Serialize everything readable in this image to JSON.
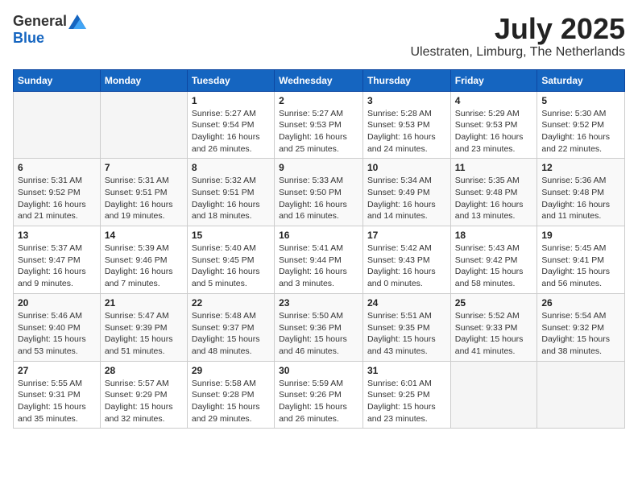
{
  "logo": {
    "general": "General",
    "blue": "Blue"
  },
  "title": {
    "month_year": "July 2025",
    "location": "Ulestraten, Limburg, The Netherlands"
  },
  "calendar": {
    "headers": [
      "Sunday",
      "Monday",
      "Tuesday",
      "Wednesday",
      "Thursday",
      "Friday",
      "Saturday"
    ],
    "weeks": [
      [
        {
          "day": "",
          "info": ""
        },
        {
          "day": "",
          "info": ""
        },
        {
          "day": "1",
          "info": "Sunrise: 5:27 AM\nSunset: 9:54 PM\nDaylight: 16 hours\nand 26 minutes."
        },
        {
          "day": "2",
          "info": "Sunrise: 5:27 AM\nSunset: 9:53 PM\nDaylight: 16 hours\nand 25 minutes."
        },
        {
          "day": "3",
          "info": "Sunrise: 5:28 AM\nSunset: 9:53 PM\nDaylight: 16 hours\nand 24 minutes."
        },
        {
          "day": "4",
          "info": "Sunrise: 5:29 AM\nSunset: 9:53 PM\nDaylight: 16 hours\nand 23 minutes."
        },
        {
          "day": "5",
          "info": "Sunrise: 5:30 AM\nSunset: 9:52 PM\nDaylight: 16 hours\nand 22 minutes."
        }
      ],
      [
        {
          "day": "6",
          "info": "Sunrise: 5:31 AM\nSunset: 9:52 PM\nDaylight: 16 hours\nand 21 minutes."
        },
        {
          "day": "7",
          "info": "Sunrise: 5:31 AM\nSunset: 9:51 PM\nDaylight: 16 hours\nand 19 minutes."
        },
        {
          "day": "8",
          "info": "Sunrise: 5:32 AM\nSunset: 9:51 PM\nDaylight: 16 hours\nand 18 minutes."
        },
        {
          "day": "9",
          "info": "Sunrise: 5:33 AM\nSunset: 9:50 PM\nDaylight: 16 hours\nand 16 minutes."
        },
        {
          "day": "10",
          "info": "Sunrise: 5:34 AM\nSunset: 9:49 PM\nDaylight: 16 hours\nand 14 minutes."
        },
        {
          "day": "11",
          "info": "Sunrise: 5:35 AM\nSunset: 9:48 PM\nDaylight: 16 hours\nand 13 minutes."
        },
        {
          "day": "12",
          "info": "Sunrise: 5:36 AM\nSunset: 9:48 PM\nDaylight: 16 hours\nand 11 minutes."
        }
      ],
      [
        {
          "day": "13",
          "info": "Sunrise: 5:37 AM\nSunset: 9:47 PM\nDaylight: 16 hours\nand 9 minutes."
        },
        {
          "day": "14",
          "info": "Sunrise: 5:39 AM\nSunset: 9:46 PM\nDaylight: 16 hours\nand 7 minutes."
        },
        {
          "day": "15",
          "info": "Sunrise: 5:40 AM\nSunset: 9:45 PM\nDaylight: 16 hours\nand 5 minutes."
        },
        {
          "day": "16",
          "info": "Sunrise: 5:41 AM\nSunset: 9:44 PM\nDaylight: 16 hours\nand 3 minutes."
        },
        {
          "day": "17",
          "info": "Sunrise: 5:42 AM\nSunset: 9:43 PM\nDaylight: 16 hours\nand 0 minutes."
        },
        {
          "day": "18",
          "info": "Sunrise: 5:43 AM\nSunset: 9:42 PM\nDaylight: 15 hours\nand 58 minutes."
        },
        {
          "day": "19",
          "info": "Sunrise: 5:45 AM\nSunset: 9:41 PM\nDaylight: 15 hours\nand 56 minutes."
        }
      ],
      [
        {
          "day": "20",
          "info": "Sunrise: 5:46 AM\nSunset: 9:40 PM\nDaylight: 15 hours\nand 53 minutes."
        },
        {
          "day": "21",
          "info": "Sunrise: 5:47 AM\nSunset: 9:39 PM\nDaylight: 15 hours\nand 51 minutes."
        },
        {
          "day": "22",
          "info": "Sunrise: 5:48 AM\nSunset: 9:37 PM\nDaylight: 15 hours\nand 48 minutes."
        },
        {
          "day": "23",
          "info": "Sunrise: 5:50 AM\nSunset: 9:36 PM\nDaylight: 15 hours\nand 46 minutes."
        },
        {
          "day": "24",
          "info": "Sunrise: 5:51 AM\nSunset: 9:35 PM\nDaylight: 15 hours\nand 43 minutes."
        },
        {
          "day": "25",
          "info": "Sunrise: 5:52 AM\nSunset: 9:33 PM\nDaylight: 15 hours\nand 41 minutes."
        },
        {
          "day": "26",
          "info": "Sunrise: 5:54 AM\nSunset: 9:32 PM\nDaylight: 15 hours\nand 38 minutes."
        }
      ],
      [
        {
          "day": "27",
          "info": "Sunrise: 5:55 AM\nSunset: 9:31 PM\nDaylight: 15 hours\nand 35 minutes."
        },
        {
          "day": "28",
          "info": "Sunrise: 5:57 AM\nSunset: 9:29 PM\nDaylight: 15 hours\nand 32 minutes."
        },
        {
          "day": "29",
          "info": "Sunrise: 5:58 AM\nSunset: 9:28 PM\nDaylight: 15 hours\nand 29 minutes."
        },
        {
          "day": "30",
          "info": "Sunrise: 5:59 AM\nSunset: 9:26 PM\nDaylight: 15 hours\nand 26 minutes."
        },
        {
          "day": "31",
          "info": "Sunrise: 6:01 AM\nSunset: 9:25 PM\nDaylight: 15 hours\nand 23 minutes."
        },
        {
          "day": "",
          "info": ""
        },
        {
          "day": "",
          "info": ""
        }
      ]
    ]
  }
}
